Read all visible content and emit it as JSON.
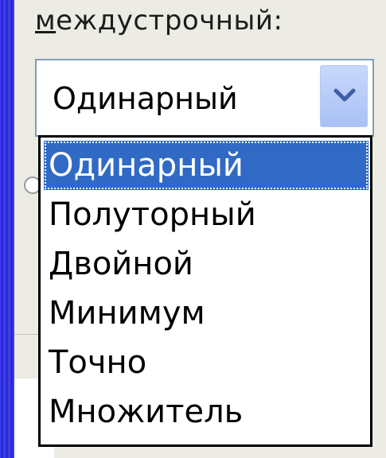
{
  "field_label": {
    "text": "междустрочный:",
    "accelerator": "м",
    "rest": "еждустрочный:"
  },
  "combo": {
    "value": "Одинарный",
    "button_icon": "chevron-down-icon"
  },
  "options": [
    {
      "label": "Одинарный",
      "selected": true
    },
    {
      "label": "Полуторный",
      "selected": false
    },
    {
      "label": "Двойной",
      "selected": false
    },
    {
      "label": "Минимум",
      "selected": false
    },
    {
      "label": "Точно",
      "selected": false
    },
    {
      "label": "Множитель",
      "selected": false
    }
  ],
  "colors": {
    "selection": "#316ac5",
    "dialog_bg": "#ecebe4",
    "combo_border": "#7f9db9",
    "button": "#a9c1f5",
    "background": "#2d2fd8"
  }
}
